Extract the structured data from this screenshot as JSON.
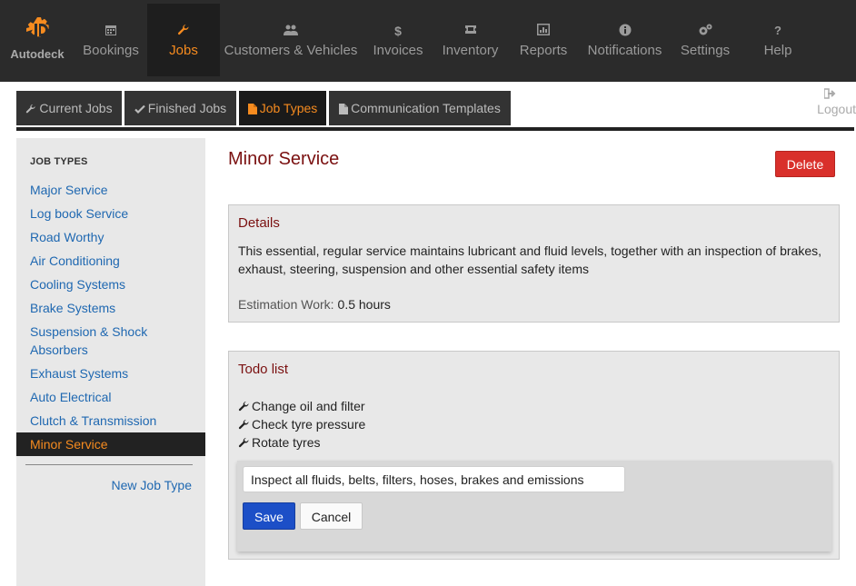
{
  "app": {
    "brand": "Autodeck"
  },
  "nav": {
    "items": [
      {
        "label": "Bookings",
        "icon": "calendar-icon"
      },
      {
        "label": "Jobs",
        "icon": "wrench-icon",
        "active": true
      },
      {
        "label": "Customers & Vehicles",
        "icon": "users-icon"
      },
      {
        "label": "Invoices",
        "icon": "dollar-icon"
      },
      {
        "label": "Inventory",
        "icon": "ticket-icon"
      },
      {
        "label": "Reports",
        "icon": "chart-icon"
      },
      {
        "label": "Notifications",
        "icon": "info-icon"
      },
      {
        "label": "Settings",
        "icon": "cogs-icon"
      },
      {
        "label": "Help",
        "icon": "question-icon"
      }
    ]
  },
  "subnav": {
    "tabs": [
      {
        "label": "Current Jobs",
        "icon": "wrench-icon"
      },
      {
        "label": "Finished Jobs",
        "icon": "check-icon"
      },
      {
        "label": "Job Types",
        "icon": "file-icon",
        "active": true
      },
      {
        "label": "Communication Templates",
        "icon": "file-icon"
      }
    ],
    "logout": "Logout"
  },
  "sidebar": {
    "heading": "JOB TYPES",
    "items": [
      "Major Service",
      "Log book Service",
      "Road Worthy",
      "Air Conditioning",
      "Cooling Systems",
      "Brake Systems",
      "Suspension & Shock Absorbers",
      "Exhaust Systems",
      "Auto Electrical",
      "Clutch & Transmission",
      "Minor Service"
    ],
    "active_index": 10,
    "new_job_type": "New Job Type"
  },
  "main": {
    "title": "Minor Service",
    "delete_label": "Delete",
    "details": {
      "title": "Details",
      "description": "This essential, regular service maintains lubricant and fluid levels, together with an inspection of brakes, exhaust, steering, suspension and other essential safety items",
      "estimation_label": "Estimation Work:",
      "estimation_value": "0.5 hours"
    },
    "todo": {
      "title": "Todo list",
      "items": [
        "Change oil and filter",
        "Check tyre pressure",
        "Rotate tyres"
      ],
      "input_value": "Inspect all fluids, belts, filters, hoses, brakes and emissions",
      "save_label": "Save",
      "cancel_label": "Cancel"
    }
  },
  "colors": {
    "nav_bg": "#2b2b2b",
    "accent": "#f68b1f",
    "title_red": "#7a1010",
    "link_blue": "#1f68b1",
    "danger": "#d9302b",
    "primary": "#1c4fc7"
  }
}
